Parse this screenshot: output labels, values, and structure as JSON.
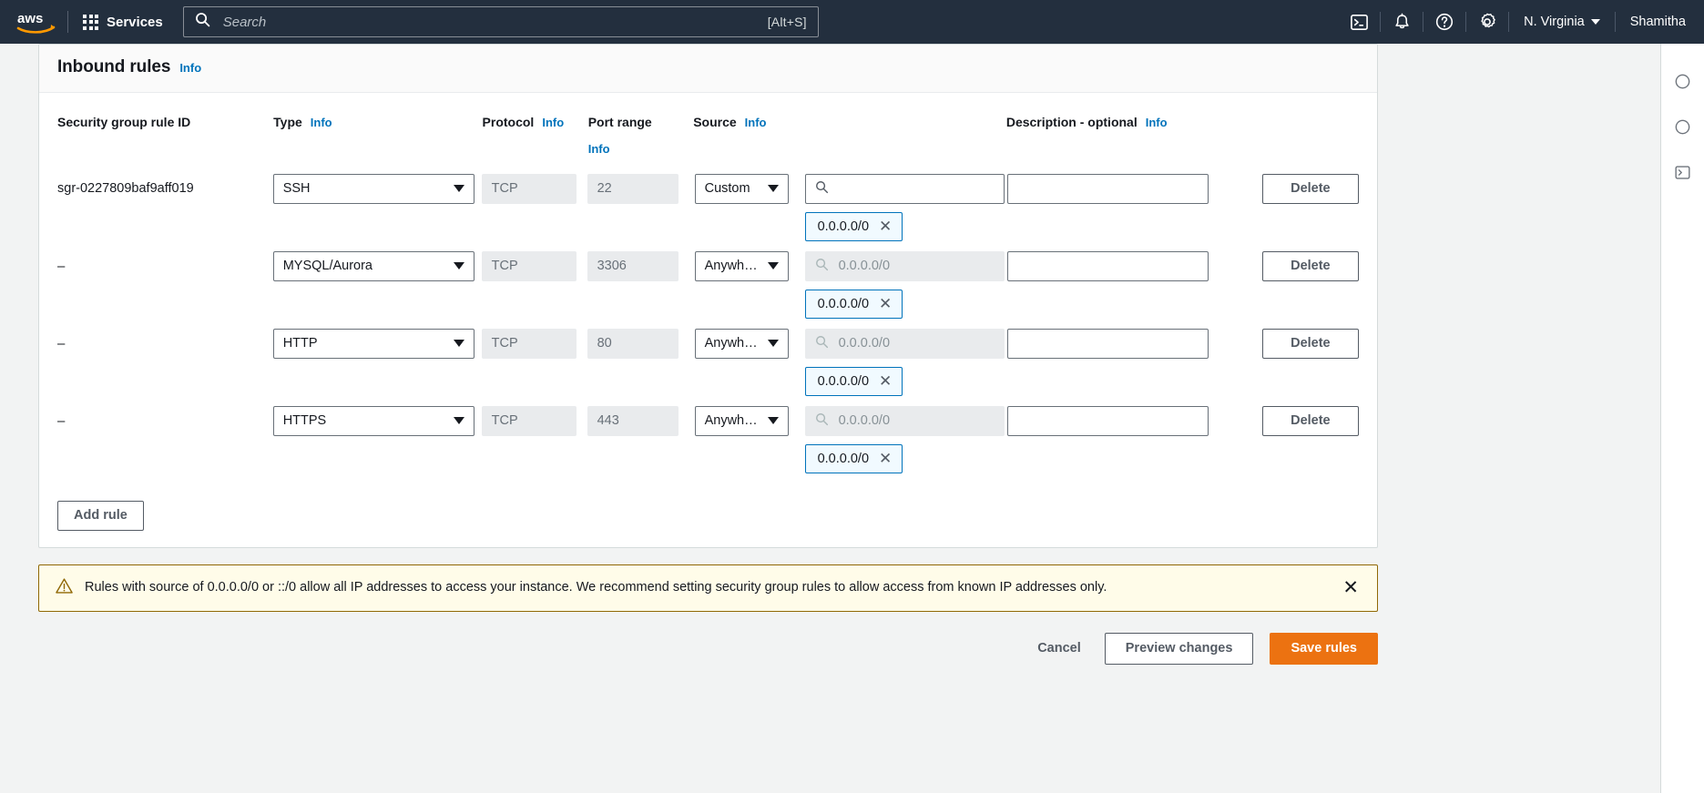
{
  "topnav": {
    "logo_alt": "aws",
    "services_label": "Services",
    "search": {
      "placeholder": "Search",
      "value": "",
      "shortcut": "[Alt+S]"
    },
    "icons": [
      {
        "name": "cloudshell-icon",
        "title": "CloudShell"
      },
      {
        "name": "notifications-bell-icon",
        "title": "Notifications"
      },
      {
        "name": "help-question-icon",
        "title": "Help"
      },
      {
        "name": "settings-gear-icon",
        "title": "Settings"
      }
    ],
    "region": "N. Virginia",
    "account": "Shamitha"
  },
  "panel": {
    "title": "Inbound rules",
    "info_label": "Info"
  },
  "table": {
    "headers": [
      {
        "label": "Security group rule ID",
        "info": ""
      },
      {
        "label": "Type",
        "info": "Info"
      },
      {
        "label": "Protocol",
        "info": "Info"
      },
      {
        "label": "Port range",
        "info": "Info"
      },
      {
        "label": "Source",
        "info": "Info"
      },
      {
        "label": "Description - optional",
        "info": "Info"
      },
      {
        "label": "",
        "info": ""
      }
    ],
    "rows": [
      {
        "rule_id": "sgr-0227809baf9aff019",
        "type": "SSH",
        "protocol": "TCP",
        "port_range": "22",
        "source_type": "Custom",
        "source_value": "",
        "source_placeholder": "",
        "source_disabled": false,
        "chip": "0.0.0.0/0",
        "description": "",
        "delete_label": "Delete"
      },
      {
        "rule_id": "–",
        "type": "MYSQL/Aurora",
        "protocol": "TCP",
        "port_range": "3306",
        "source_type": "Anywh…",
        "source_value": "",
        "source_placeholder": "0.0.0.0/0",
        "source_disabled": true,
        "chip": "0.0.0.0/0",
        "description": "",
        "delete_label": "Delete"
      },
      {
        "rule_id": "–",
        "type": "HTTP",
        "protocol": "TCP",
        "port_range": "80",
        "source_type": "Anywh…",
        "source_value": "",
        "source_placeholder": "0.0.0.0/0",
        "source_disabled": true,
        "chip": "0.0.0.0/0",
        "description": "",
        "delete_label": "Delete"
      },
      {
        "rule_id": "–",
        "type": "HTTPS",
        "protocol": "TCP",
        "port_range": "443",
        "source_type": "Anywh…",
        "source_value": "",
        "source_placeholder": "0.0.0.0/0",
        "source_disabled": true,
        "chip": "0.0.0.0/0",
        "description": "",
        "delete_label": "Delete"
      }
    ],
    "add_rule_label": "Add rule"
  },
  "alert": {
    "icon": "warning-triangle-icon",
    "message": "Rules with source of 0.0.0.0/0 or ::/0 allow all IP addresses to access your instance. We recommend setting security group rules to allow access from known IP addresses only.",
    "close_label": "✕"
  },
  "footer": {
    "cancel_label": "Cancel",
    "preview_label": "Preview changes",
    "save_label": "Save rules"
  },
  "colors": {
    "nav_bg": "#232f3e",
    "accent_orange": "#ec7211",
    "link_blue": "#0073bb",
    "warning_bg": "#fffce9",
    "warning_border": "#906806"
  }
}
